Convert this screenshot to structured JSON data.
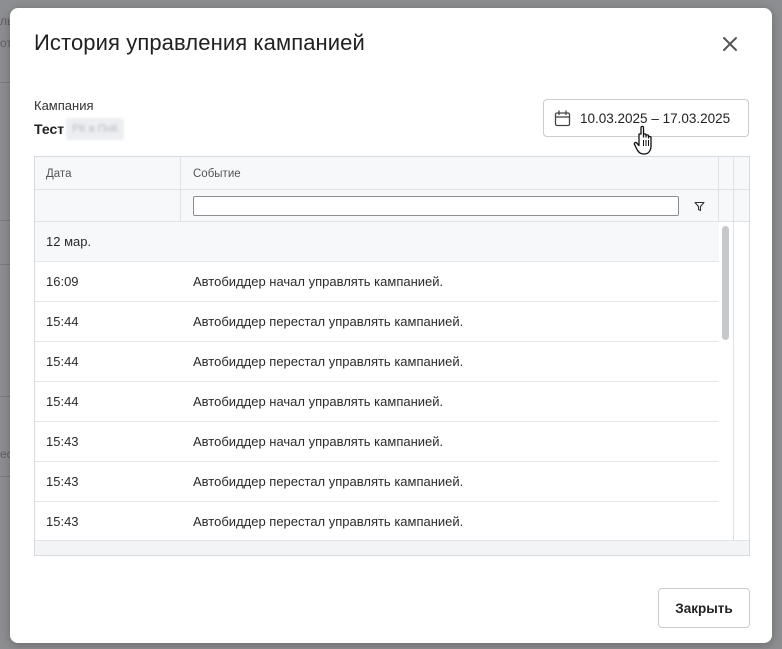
{
  "modal": {
    "title": "История управления кампанией",
    "close_button_label": "Закрыть"
  },
  "campaign": {
    "label": "Кампания",
    "name_visible": "Тест",
    "name_hidden": "РК в ПнК"
  },
  "date_range": {
    "value": "10.03.2025 – 17.03.2025",
    "icon": "calendar-icon"
  },
  "grid": {
    "columns": [
      "Дата",
      "Событие"
    ],
    "filter": {
      "value": "",
      "icon": "filter-icon"
    },
    "group": "12 мар.",
    "rows": [
      {
        "time": "16:09",
        "event": "Автобиддер начал управлять кампанией."
      },
      {
        "time": "15:44",
        "event": "Автобиддер перестал управлять кампанией."
      },
      {
        "time": "15:44",
        "event": "Автобиддер перестал управлять кампанией."
      },
      {
        "time": "15:44",
        "event": "Автобиддер начал управлять кампанией."
      },
      {
        "time": "15:43",
        "event": "Автобиддер начал управлять кампанией."
      },
      {
        "time": "15:43",
        "event": "Автобиддер перестал управлять кампанией."
      },
      {
        "time": "15:43",
        "event": "Автобиддер перестал управлять кампанией."
      }
    ]
  },
  "backdrop": {
    "fragments": [
      "ль",
      "от",
      "ес"
    ]
  },
  "colors": {
    "overlay": "#8f8f92",
    "border": "#c9ccd1",
    "header_bg": "#f7f8fa"
  }
}
